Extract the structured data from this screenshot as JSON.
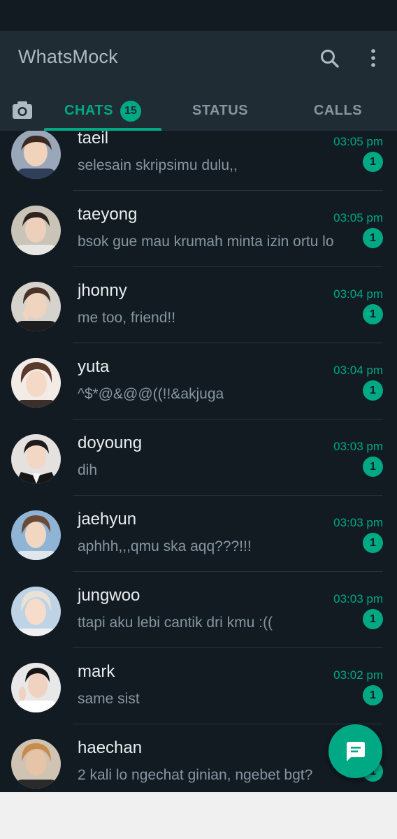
{
  "app": {
    "title": "WhatsMock"
  },
  "header": {
    "search_icon": "search-icon",
    "menu_icon": "more-vertical-icon"
  },
  "tabs": [
    {
      "label": "CHATS",
      "badge": "15",
      "active": true
    },
    {
      "label": "STATUS",
      "active": false
    },
    {
      "label": "CALLS",
      "active": false
    }
  ],
  "chats": [
    {
      "name": "taeil",
      "time": "03:05 pm",
      "message": "selesain skripsimu dulu,,",
      "unread": "1"
    },
    {
      "name": "taeyong",
      "time": "03:05 pm",
      "message": "bsok gue mau krumah minta izin ortu lo",
      "unread": "1"
    },
    {
      "name": "jhonny",
      "time": "03:04 pm",
      "message": "me too, friend!!",
      "unread": "1"
    },
    {
      "name": "yuta",
      "time": "03:04 pm",
      "message": "^$*@&@@((!!&akjuga",
      "unread": "1"
    },
    {
      "name": "doyoung",
      "time": "03:03 pm",
      "message": "dih",
      "unread": "1"
    },
    {
      "name": "jaehyun",
      "time": "03:03 pm",
      "message": "aphhh,,,qmu ska aqq???!!!",
      "unread": "1"
    },
    {
      "name": "jungwoo",
      "time": "03:03 pm",
      "message": "ttapi aku lebi cantik dri kmu :((",
      "unread": "1"
    },
    {
      "name": "mark",
      "time": "03:02 pm",
      "message": "same sist",
      "unread": "1"
    },
    {
      "name": "haechan",
      "time": "",
      "message": "2 kali lo ngechat ginian, ngebet bgt?",
      "unread": "1"
    }
  ],
  "fab": {
    "icon": "new-chat-icon"
  },
  "colors": {
    "accent": "#00a884",
    "background": "#121b22",
    "header": "#1f2c34"
  }
}
